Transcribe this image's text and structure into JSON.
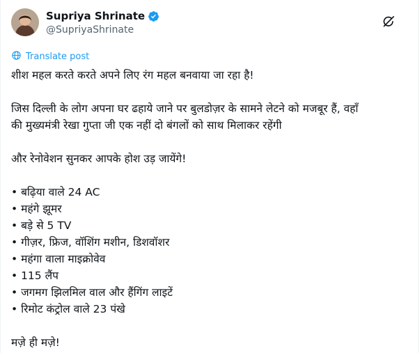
{
  "author": {
    "name": "Supriya Shrinate",
    "handle": "@SupriyaShrinate"
  },
  "translate_label": "Translate post",
  "paragraphs": {
    "p1": "शीश महल करते करते अपने लिए रंग महल बनवाया जा रहा है!",
    "p2_line1": "जिस दिल्ली के लोग अपना घर ढहाये जाने पर बुलडोज़र के सामने लेटने को मजबूर हैं, वहाँ",
    "p2_line2": "की मुख्यमंत्री रेखा गुप्ता जी एक नहीं दो बंगलों को साथ मिलाकर रहेंगी",
    "p3": "और रेनोवेशन सुनकर आपके होश उड़ जायेंगे!",
    "bullets": [
      "• बढ़िया वाले 24 AC",
      "• महंगे झूमर",
      "• बड़े से 5 TV",
      "• गीज़र, फ्रिज, वॉशिंग मशीन, डिशवॉशर",
      "• महंगा वाला माइक्रोवेव",
      "• 115 लैंप",
      "• जगमग झिलमिल वाल और हैंगिंग लाइटें",
      "• रिमोट कंट्रोल वाले 23 पंखे"
    ],
    "closing": "मज़े ही मज़े!"
  },
  "colors": {
    "text": "#0f1419",
    "muted": "#536471",
    "accent": "#1d9bf0"
  },
  "icons": {
    "verified": "verified-badge-icon",
    "grok": "grok-icon",
    "translate": "translate-globe-icon"
  }
}
